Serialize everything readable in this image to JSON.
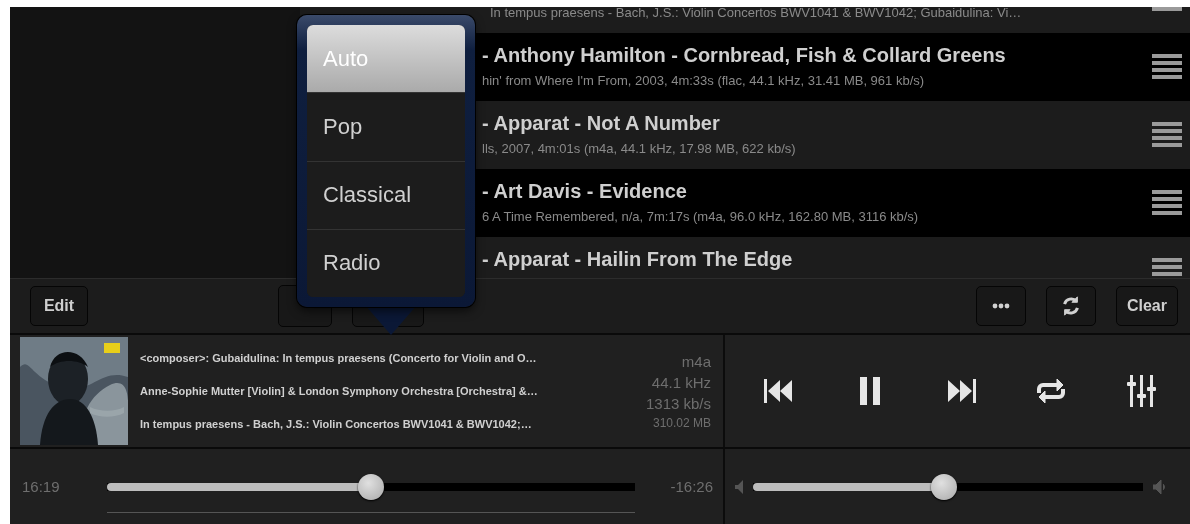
{
  "playlist": {
    "rows": [
      {
        "subtitle": "In tempus praesens - Bach, J.S.: Violin Concertos BWV1041 & BWV1042; Gubaidulina: Vi…"
      },
      {
        "title": "- Anthony Hamilton - Cornbread, Fish & Collard Greens",
        "subtitle": "hin' from Where I'm From, 2003,  4m:33s (flac, 44.1 kHz, 31.41 MB, 961 kb/s)"
      },
      {
        "title": "- Apparat - Not A Number",
        "subtitle": "lls, 2007,  4m:01s (m4a, 44.1 kHz, 17.98 MB, 622 kb/s)"
      },
      {
        "title": "- Art Davis - Evidence",
        "subtitle": "6 A Time Remembered, n/a,  7m:17s (m4a, 96.0 kHz, 162.80 MB, 3116 kb/s)"
      },
      {
        "title": "- Apparat - Hailin From The Edge"
      }
    ]
  },
  "mode_menu": {
    "items": [
      {
        "label": "Auto",
        "selected": true
      },
      {
        "label": "Pop",
        "selected": false
      },
      {
        "label": "Classical",
        "selected": false
      },
      {
        "label": "Radio",
        "selected": false
      }
    ]
  },
  "toolbar": {
    "left": [
      {
        "kind": "text",
        "label": "Edit"
      },
      {
        "kind": "plain"
      },
      {
        "kind": "plain"
      }
    ],
    "right": [
      {
        "kind": "more"
      },
      {
        "kind": "refresh"
      },
      {
        "kind": "text",
        "label": "Clear"
      }
    ]
  },
  "now_playing": {
    "lines": [
      "<composer>: Gubaidulina: In tempus praesens (Concerto for Violin and O…",
      "Anne-Sophie Mutter [Violin] & London Symphony Orchestra [Orchestra] &…",
      "In tempus praesens - Bach, J.S.: Violin Concertos BWV1041 & BWV1042;…"
    ],
    "format": [
      "m4a",
      "44.1 kHz",
      "1313 kb/s",
      "310.02 MB"
    ]
  },
  "transport": [
    {
      "kind": "previous"
    },
    {
      "kind": "pause"
    },
    {
      "kind": "next"
    },
    {
      "kind": "repeat"
    },
    {
      "kind": "equalizer"
    }
  ],
  "progress": {
    "elapsed": "16:19",
    "remaining": "-16:26",
    "level": 0.5
  },
  "volume": {
    "level": 0.49
  }
}
